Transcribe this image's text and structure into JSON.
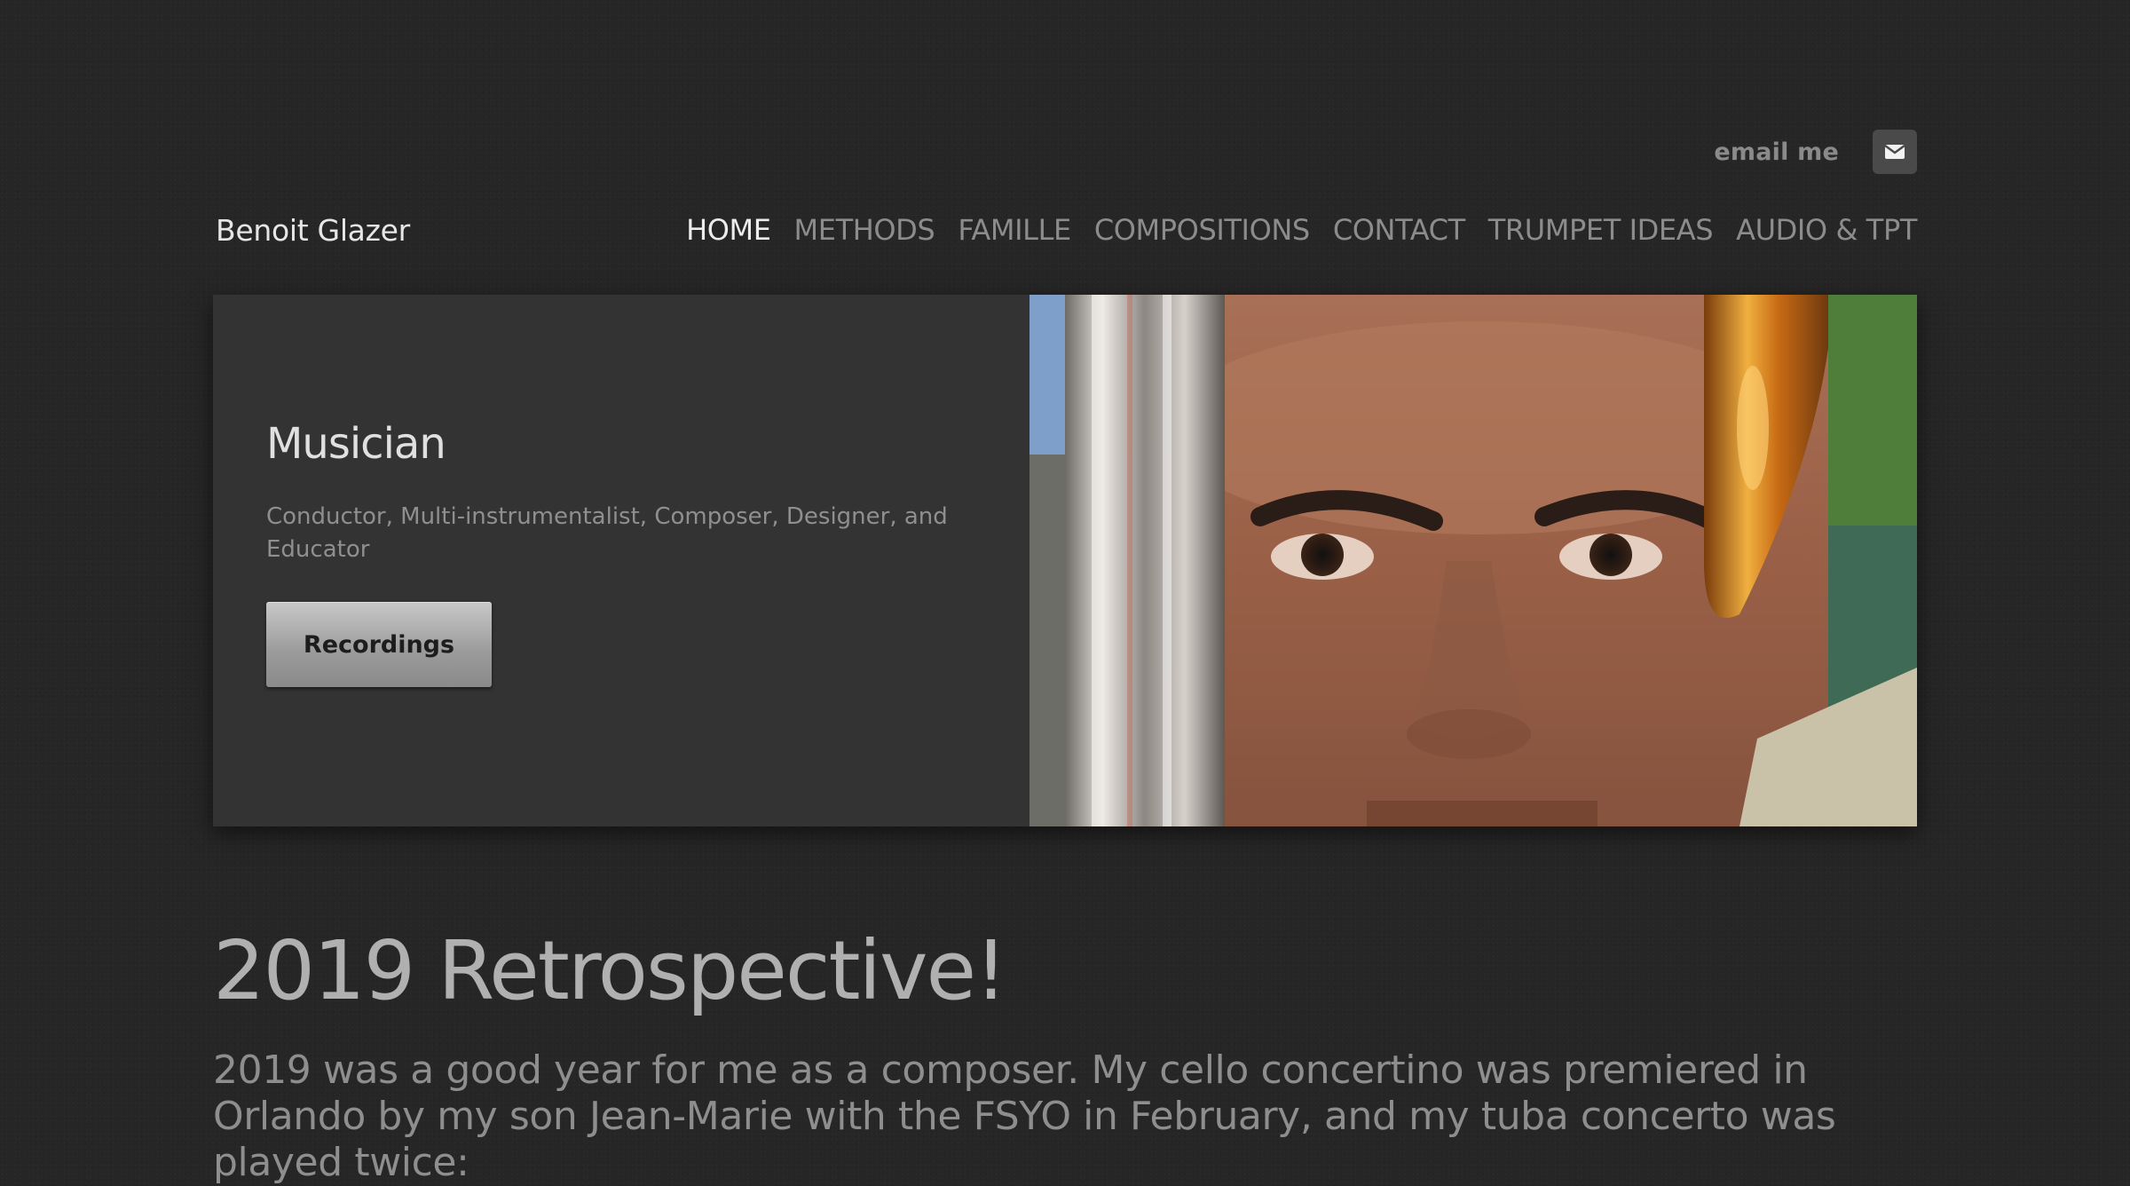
{
  "header": {
    "email_label": "email me",
    "site_title": "Benoit Glazer",
    "nav": [
      {
        "label": "HOME",
        "active": true
      },
      {
        "label": "METHODS",
        "active": false
      },
      {
        "label": "FAMILLE",
        "active": false
      },
      {
        "label": "COMPOSITIONS",
        "active": false
      },
      {
        "label": "CONTACT",
        "active": false
      },
      {
        "label": "TRUMPET IDEAS",
        "active": false
      },
      {
        "label": "AUDIO & TPT",
        "active": false
      }
    ]
  },
  "hero": {
    "title": "Musician",
    "subtitle": "Conductor, Multi-instrumentalist, Composer, Designer, and Educator",
    "button_label": "Recordings",
    "image_icon": "portrait-with-trumpets-photo"
  },
  "article": {
    "title": "2019 Retrospective!",
    "body": "2019 was a good year for me as a composer. My cello concertino was premiered in Orlando by my son Jean-Marie with the FSYO in February, and my tuba concerto was played twice:"
  },
  "colors": {
    "background": "#262626",
    "hero_panel": "#333333",
    "nav_active": "#ececec",
    "nav_inactive": "#8c8c8c"
  }
}
